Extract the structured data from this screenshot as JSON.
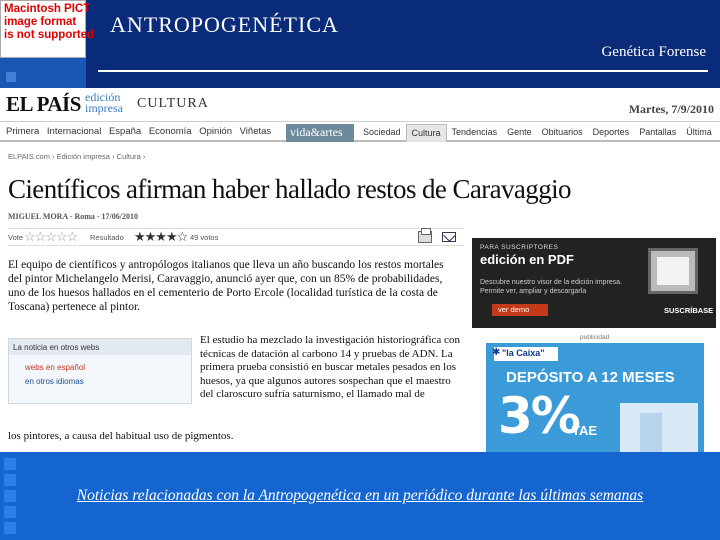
{
  "slide": {
    "title": "ANTROPOGENÉTICA",
    "subtitle": "Genética Forense",
    "caption": "Noticias relacionadas con la Antropogenética en un periódico durante las últimas semanas",
    "pict_placeholder": [
      "Macintosh PICT",
      "image format",
      "is not supported"
    ],
    "colors": {
      "background": "#0a2a7a",
      "band": "#1565d0",
      "accent": "#1c4fa8"
    }
  },
  "newspaper": {
    "logo": "EL PAÍS",
    "edition": [
      "edición",
      "impresa"
    ],
    "section": "CULTURA",
    "date": "Martes, 7/9/2010",
    "nav_left": [
      "Primera",
      "Internacional",
      "España",
      "Economía",
      "Opinión",
      "Viñetas"
    ],
    "nav_vida": "vida&artes",
    "nav_right": [
      {
        "label": "Sociedad",
        "active": false
      },
      {
        "label": "Cultura",
        "active": true
      },
      {
        "label": "Tendencias",
        "active": false
      },
      {
        "label": "Gente",
        "active": false
      },
      {
        "label": "Obituarios",
        "active": false
      },
      {
        "label": "Deportes",
        "active": false
      },
      {
        "label": "Pantallas",
        "active": false
      },
      {
        "label": "Última",
        "active": false
      }
    ],
    "breadcrumb": "ELPAIS.com  ›  Edición impresa  ›  Cultura  ›",
    "headline": "Científicos afirman haber hallado restos de Caravaggio",
    "byline": "MIGUEL MORA - Roma - 17/06/2010",
    "rating": {
      "vote_label": "Vote",
      "result_label": "Resultado",
      "score_stars": 4,
      "votes": "49 votos"
    },
    "lead": "El equipo de científicos y antropólogos italianos que lleva un año buscando los restos mortales del pintor Michelangelo Merisi, Caravaggio, anunció ayer que, con un 85% de probabilidades, uno de los huesos hallados en el cementerio de Porto Ercole (localidad turística de la costa de Toscana) pertenece al pintor.",
    "body": "El estudio ha mezclado la investigación historiográfica con técnicas de datación al carbono 14 y pruebas de ADN. La primera prueba consistió en buscar metales pesados en los huesos, ya que algunos autores sospechan que el maestro del claroscuro sufría saturnismo, el llamado mal de",
    "tail": "los pintores, a causa del habitual uso de pigmentos.",
    "webs_box": {
      "header": "La noticia en otros webs",
      "link_es": "webs en español",
      "link_other": "en otros idiomas"
    },
    "pdf_ad": {
      "kicker": "PARA SUSCRIPTORES",
      "title": "edición en PDF",
      "text": "Descubre nuestro visor de la edición impresa. Permite ver, ampliar y descargarla",
      "demo": "ver demo",
      "subscribe": "SUSCRÍBASE"
    },
    "ad_label": "publicidad",
    "bank_ad": {
      "brand": "\"la Caixa\"",
      "headline": "DEPÓSITO A 12 MESES",
      "rate": "3%",
      "rate_unit": "TAE"
    }
  }
}
